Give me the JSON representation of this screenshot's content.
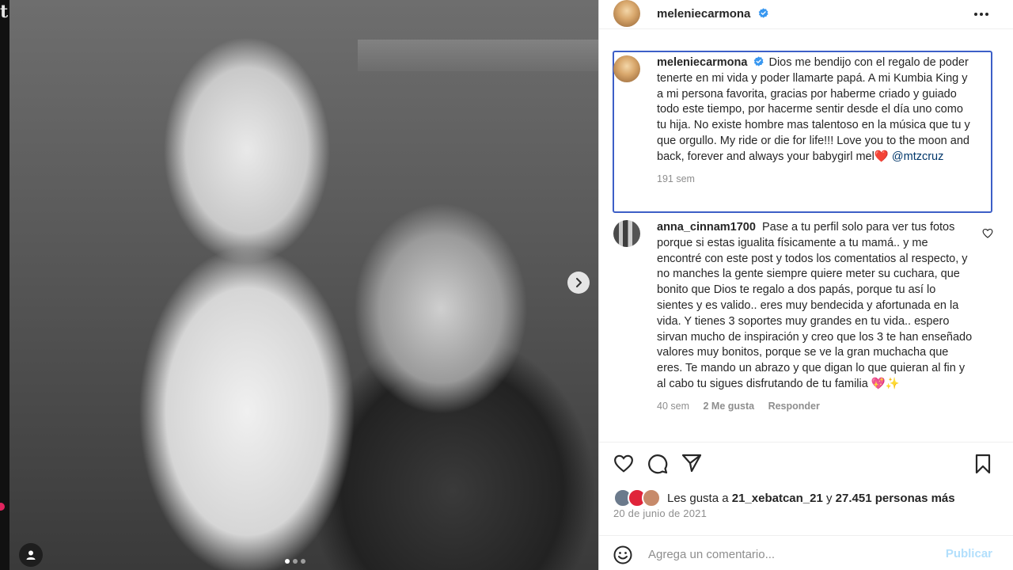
{
  "post": {
    "author": "meleniecarmona",
    "verified": true,
    "caption_text": "Dios me bendijo con el regalo de poder tenerte en mi vida y poder llamarte papá. A mi Kumbia King y a mi persona favorita, gracias por haberme criado y guiado todo este tiempo, por hacerme sentir desde el día uno como tu hija. No existe hombre mas talentoso en la música que tu y que orgullo. My ride or die for life!!! Love you to the moon and back, forever and always your babygirl mel❤️",
    "caption_mention": "@mtzcruz",
    "caption_time": "191 sem",
    "slide_count": 3,
    "active_slide": 1
  },
  "photo": {
    "edge_glyph": "t"
  },
  "comments": [
    {
      "username": "anna_cinnam1700",
      "text": "Pase a tu perfil solo para ver tus fotos porque si estas igualita físicamente a tu mamá.. y me encontré con este post y todos los comentatios al respecto, y no manches la gente siempre quiere meter su cuchara, que bonito que Dios te regalo a dos papás, porque tu así lo sientes y es valido.. eres muy bendecida y afortunada en la vida. Y tienes 3 soportes muy grandes en tu vida.. espero sirvan mucho de inspiración y creo que los 3 te han enseñado valores muy bonitos, porque se ve la gran muchacha que eres. Te mando un abrazo y que digan lo que quieran al fin y al cabo tu sigues disfrutando de tu familia 💖✨",
      "time": "40 sem",
      "likes": "2 Me gusta",
      "reply": "Responder"
    }
  ],
  "likes": {
    "prefix": "Les gusta a",
    "first_user": "21_xebatcan_21",
    "connector": "y",
    "others": "27.451 personas más"
  },
  "date": "20 de junio de 2021",
  "add_comment": {
    "placeholder": "Agrega un comentario...",
    "value": "",
    "publish_label": "Publicar"
  },
  "colors": {
    "verified": "#3897f0",
    "mention": "#00376b",
    "focus_border": "#3d5fc7",
    "publish_disabled": "#b2dffc",
    "muted": "#8e8e8e"
  },
  "icons": {
    "next": "chevron-right-icon",
    "tagged": "user-tag-icon",
    "more": "more-horizontal-icon",
    "like": "heart-icon",
    "comment": "comment-bubble-icon",
    "share": "paper-plane-icon",
    "save": "bookmark-icon",
    "emoji": "emoji-icon"
  }
}
